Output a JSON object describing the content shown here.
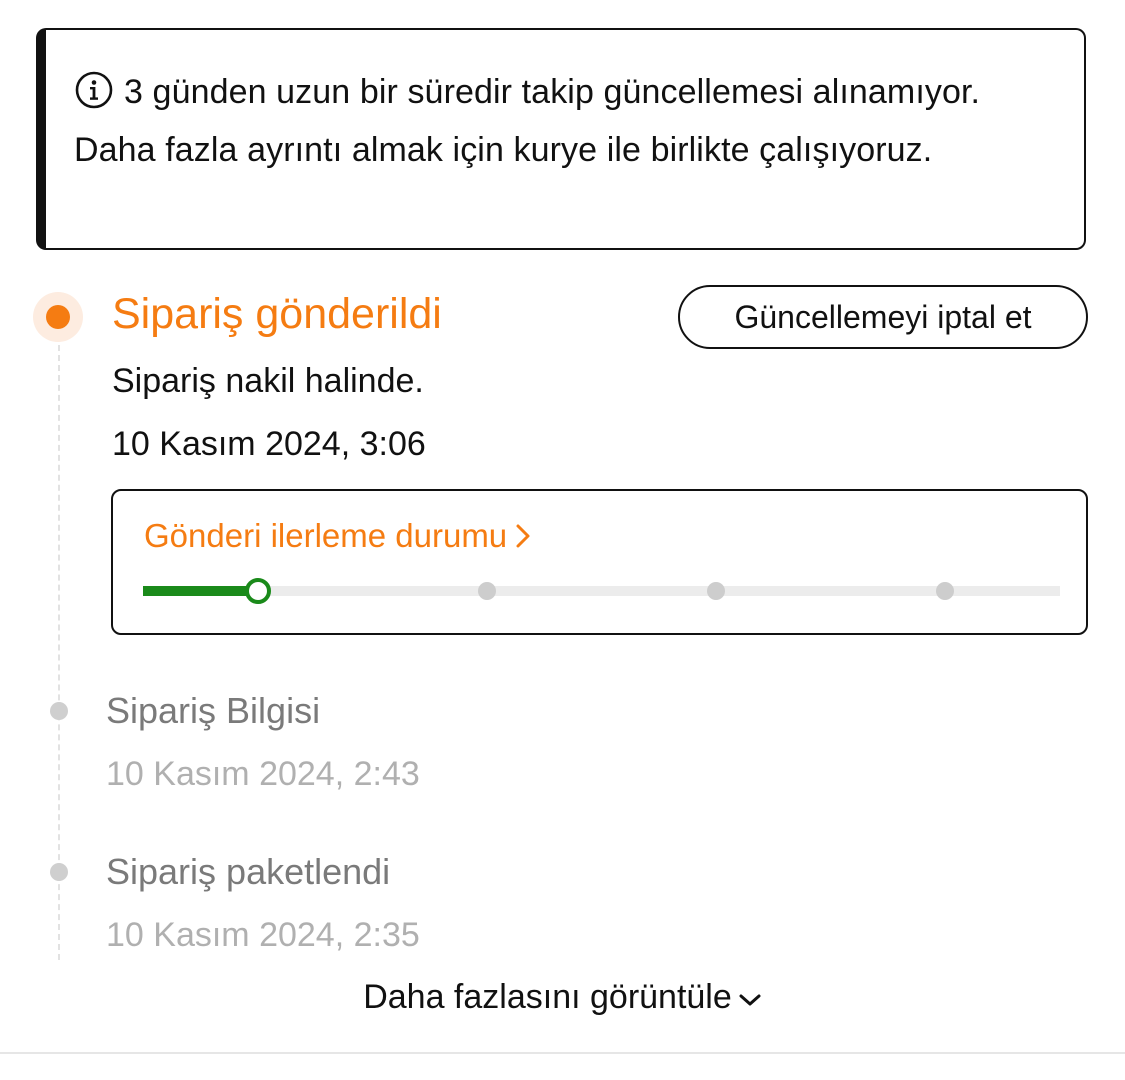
{
  "notice": {
    "text": "3 günden uzun bir süredir takip güncellemesi alınamıyor. Daha fazla ayrıntı almak için kurye ile birlikte çalışıyoruz.",
    "icon": "info-icon"
  },
  "current_step": {
    "title": "Sipariş gönderildi",
    "description": "Sipariş nakil halinde.",
    "time": "10 Kasım 2024, 3:06",
    "cancel_button": "Güncellemeyi iptal et"
  },
  "progress": {
    "link_label": "Gönderi ilerleme durumu",
    "stages_total": 5,
    "current_stage": 1,
    "colors": {
      "done": "#1a8a1a",
      "pending": "#cdcdcd"
    }
  },
  "history": [
    {
      "title": "Sipariş Bilgisi",
      "time": "10 Kasım 2024, 2:43"
    },
    {
      "title": "Sipariş paketlendi",
      "time": "10 Kasım 2024, 2:35"
    }
  ],
  "more_label": "Daha fazlasını görüntüle",
  "colors": {
    "accent": "#f57c12",
    "text": "#111111",
    "muted": "#7a7a7a",
    "muted_light": "#b0b0b0"
  }
}
